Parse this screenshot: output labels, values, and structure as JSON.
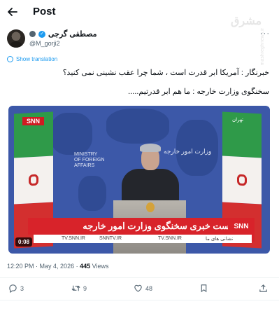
{
  "header": {
    "title": "Post",
    "back_icon": "arrow-left-icon"
  },
  "author": {
    "name": "مصطفی گرجی",
    "handle": "@M_gorji2",
    "verified_color": "#1d9bf0"
  },
  "more_label": "···",
  "show_translation": "Show translation",
  "tweet": {
    "line1": "خبرنگار : آمریکا ابر قدرت است ، شما چرا عقب نشینی نمی کنید؟",
    "line2": "سخنگوی وزارت خارجه : ما هم ابر قدرتیم....."
  },
  "media": {
    "duration": "0:08",
    "channel_tag": "SNN",
    "top_right_tag": "تهران",
    "wall_en": "MINISTRY OF FOREIGN AFFAIRS",
    "wall_fa": "وزارت امور خارجه",
    "lower_third": "نشست خبری سخنگوی وزارت امور خارجه",
    "logo": "SNN",
    "ticker": [
      "TV.SNN.IR",
      "SNNTV.IR",
      "TV.SNN.IR",
      "نشانی های ما"
    ],
    "colors": {
      "backdrop": "#3c58a8",
      "red": "#d8232a",
      "green": "#2f9a49"
    }
  },
  "meta": {
    "time": "12:20 PM",
    "date": "May 4, 2026",
    "views": "445",
    "views_label": "Views"
  },
  "actions": {
    "replies": "3",
    "reposts": "9",
    "likes": "48",
    "icons": [
      "reply-icon",
      "repost-icon",
      "like-icon",
      "bookmark-icon",
      "share-icon"
    ]
  },
  "watermark": {
    "text": "مشرق",
    "site": "mashreghnews.ir"
  }
}
